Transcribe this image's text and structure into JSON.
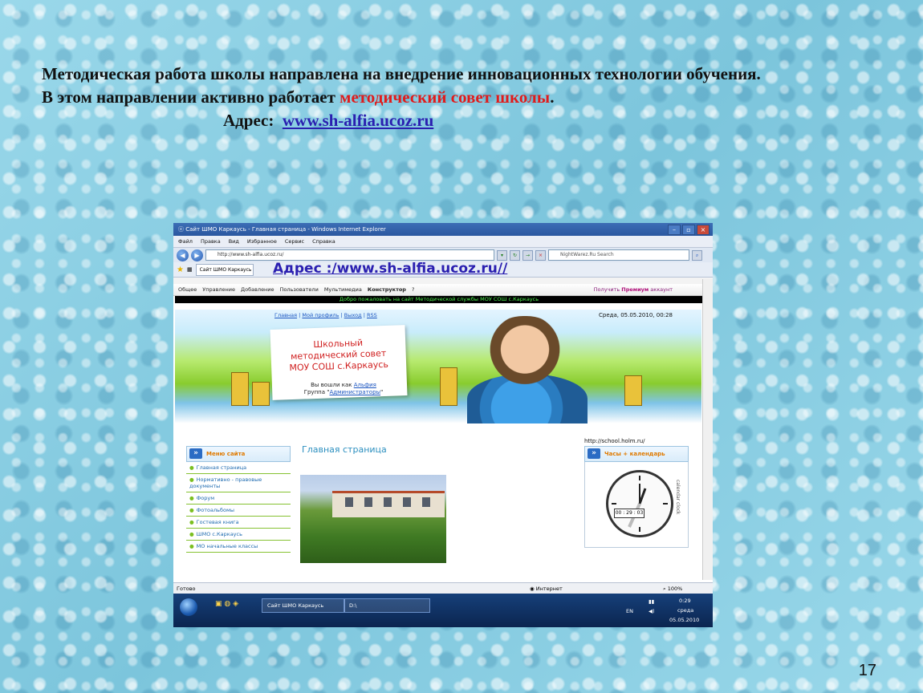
{
  "slide": {
    "line1": "Методическая работа школы направлена на внедрение инновационных технологии обучения.",
    "line2_start": "В этом направлении активно работает ",
    "line2_red": "методический совет школы",
    "line2_end": ".",
    "address_label": "Адрес:",
    "address_url": "www.sh-alfia.ucoz.ru",
    "page_number": "17"
  },
  "browser": {
    "window_title": "Сайт ШМО Каркаусь - Главная страница - Windows Internet Explorer",
    "menu": [
      "Файл",
      "Правка",
      "Вид",
      "Избранное",
      "Сервис",
      "Справка"
    ],
    "url": "http://www.sh-alfia.ucoz.ru/",
    "search_placeholder": "NightWarez.Ru Search",
    "tab_label": "Сайт ШМО Каркаусь",
    "overlay_url": "Адрес :/www.sh-alfia.ucoz.ru//",
    "status_ready": "Готово",
    "status_zone": "Интернет",
    "status_zoom": "100%"
  },
  "ucoz_bar": {
    "items": [
      "Общее",
      "Управление",
      "Добавление",
      "Пользователи",
      "Мультимедиа"
    ],
    "bold_item": "Конструктор",
    "help": "?",
    "premium_prefix": "Получить ",
    "premium_bold": "Премиум",
    "premium_suffix": " аккаунт"
  },
  "site": {
    "welcome": "Добро пожаловать на сайт Методической службы МОУ СОШ с.Каркаусь",
    "nav": [
      "Главная",
      "Мой профиль",
      "Выход",
      "RSS"
    ],
    "date": "Среда, 05.05.2010, 00:28",
    "card_title": "Школьный методический совет МОУ СОШ с.Каркаусь",
    "login_prefix": "Вы вошли как ",
    "login_user": "Альфия",
    "group_prefix": "Группа \"",
    "group_name": "Администраторы",
    "group_suffix": "\"",
    "menu_title": "Меню сайта",
    "menu_items": [
      "Главная страница",
      "Нормативно - правовые документы",
      "Форум",
      "Фотоальбомы",
      "Гостевая книга",
      "ШМО с.Каркаусь",
      "МО начальные классы"
    ],
    "main_title": "Главная страница",
    "right_url": "http://school.holm.ru/",
    "widget_title": "Часы + календарь",
    "clock_digital": "00 : 29 : 03",
    "clock_side": "calendar clock"
  },
  "taskbar": {
    "task1": "Сайт ШМО Каркаусь",
    "task2": "D:\\",
    "lang": "EN",
    "time": "0:29",
    "day": "среда",
    "date": "05.05.2010"
  }
}
